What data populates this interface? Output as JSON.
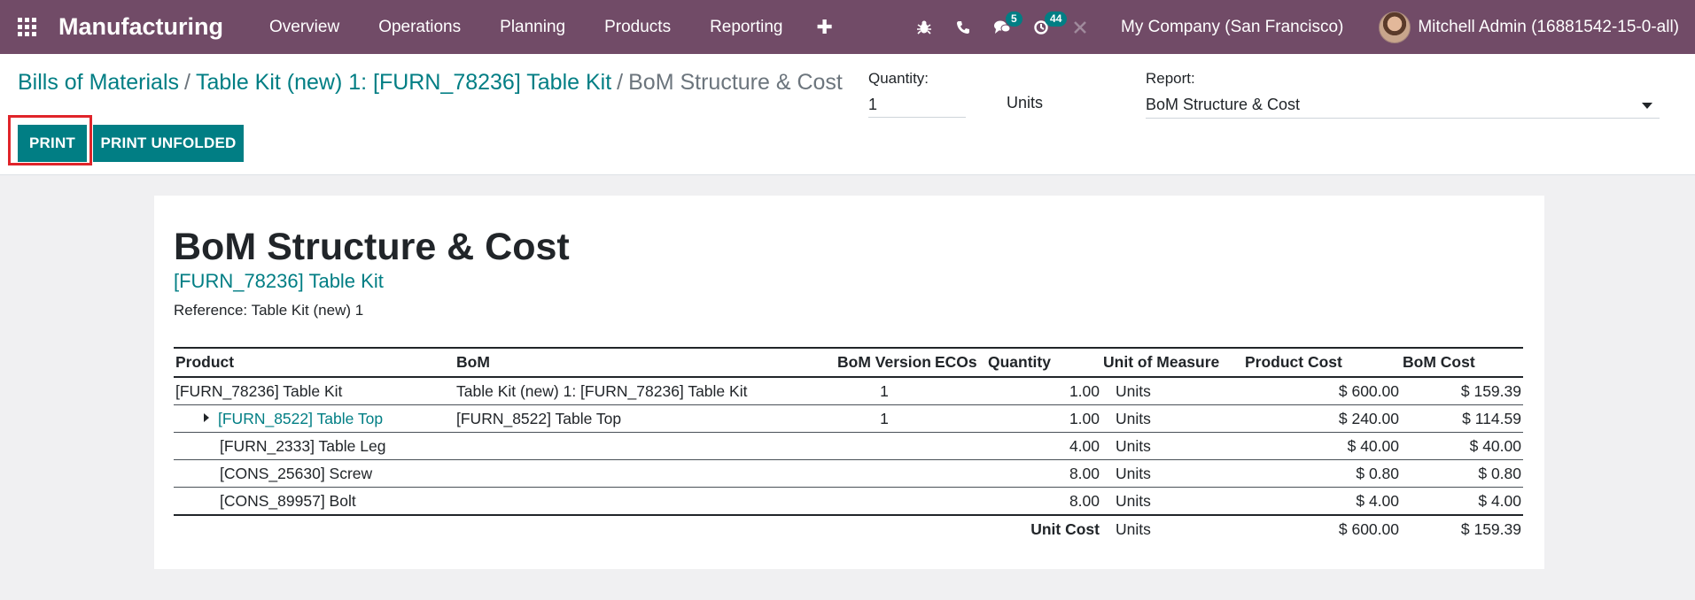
{
  "navbar": {
    "app_name": "Manufacturing",
    "menu": [
      "Overview",
      "Operations",
      "Planning",
      "Products",
      "Reporting"
    ],
    "plus": "✚",
    "messages_count": "5",
    "activities_count": "44",
    "company": "My Company (San Francisco)",
    "user": "Mitchell Admin (16881542-15-0-all)"
  },
  "breadcrumb": {
    "root": "Bills of Materials",
    "record": "Table Kit (new) 1: [FURN_78236] Table Kit",
    "current": "BoM Structure & Cost",
    "separator": "/"
  },
  "controls": {
    "quantity_label": "Quantity:",
    "quantity_value": "1",
    "units": "Units",
    "report_label": "Report:",
    "report_value": "BoM Structure & Cost",
    "print": "PRINT",
    "print_unfolded": "PRINT UNFOLDED"
  },
  "report": {
    "title": "BoM Structure & Cost",
    "subtitle": "[FURN_78236] Table Kit",
    "reference": "Reference: Table Kit (new) 1",
    "columns": [
      "Product",
      "BoM",
      "BoM Version",
      "ECOs",
      "Quantity",
      "Unit of Measure",
      "Product Cost",
      "BoM Cost"
    ],
    "rows": [
      {
        "product": "[FURN_78236] Table Kit",
        "bom": "Table Kit (new) 1: [FURN_78236] Table Kit",
        "version": "1",
        "ecos": "",
        "qty": "1.00",
        "uom": "Units",
        "product_cost": "$ 600.00",
        "bom_cost": "$ 159.39"
      },
      {
        "product": "[FURN_8522] Table Top",
        "bom": "[FURN_8522] Table Top",
        "version": "1",
        "ecos": "",
        "qty": "1.00",
        "uom": "Units",
        "product_cost": "$ 240.00",
        "bom_cost": "$ 114.59"
      },
      {
        "product": "[FURN_2333] Table Leg",
        "bom": "",
        "version": "",
        "ecos": "",
        "qty": "4.00",
        "uom": "Units",
        "product_cost": "$ 40.00",
        "bom_cost": "$ 40.00"
      },
      {
        "product": "[CONS_25630] Screw",
        "bom": "",
        "version": "",
        "ecos": "",
        "qty": "8.00",
        "uom": "Units",
        "product_cost": "$ 0.80",
        "bom_cost": "$ 0.80"
      },
      {
        "product": "[CONS_89957] Bolt",
        "bom": "",
        "version": "",
        "ecos": "",
        "qty": "8.00",
        "uom": "Units",
        "product_cost": "$ 4.00",
        "bom_cost": "$ 4.00"
      }
    ],
    "footer": {
      "label": "Unit Cost",
      "uom": "Units",
      "product_cost": "$ 600.00",
      "bom_cost": "$ 159.39"
    }
  },
  "colors": {
    "navbar": "#714b67",
    "accent": "#017e84",
    "highlight": "#e0242a"
  }
}
